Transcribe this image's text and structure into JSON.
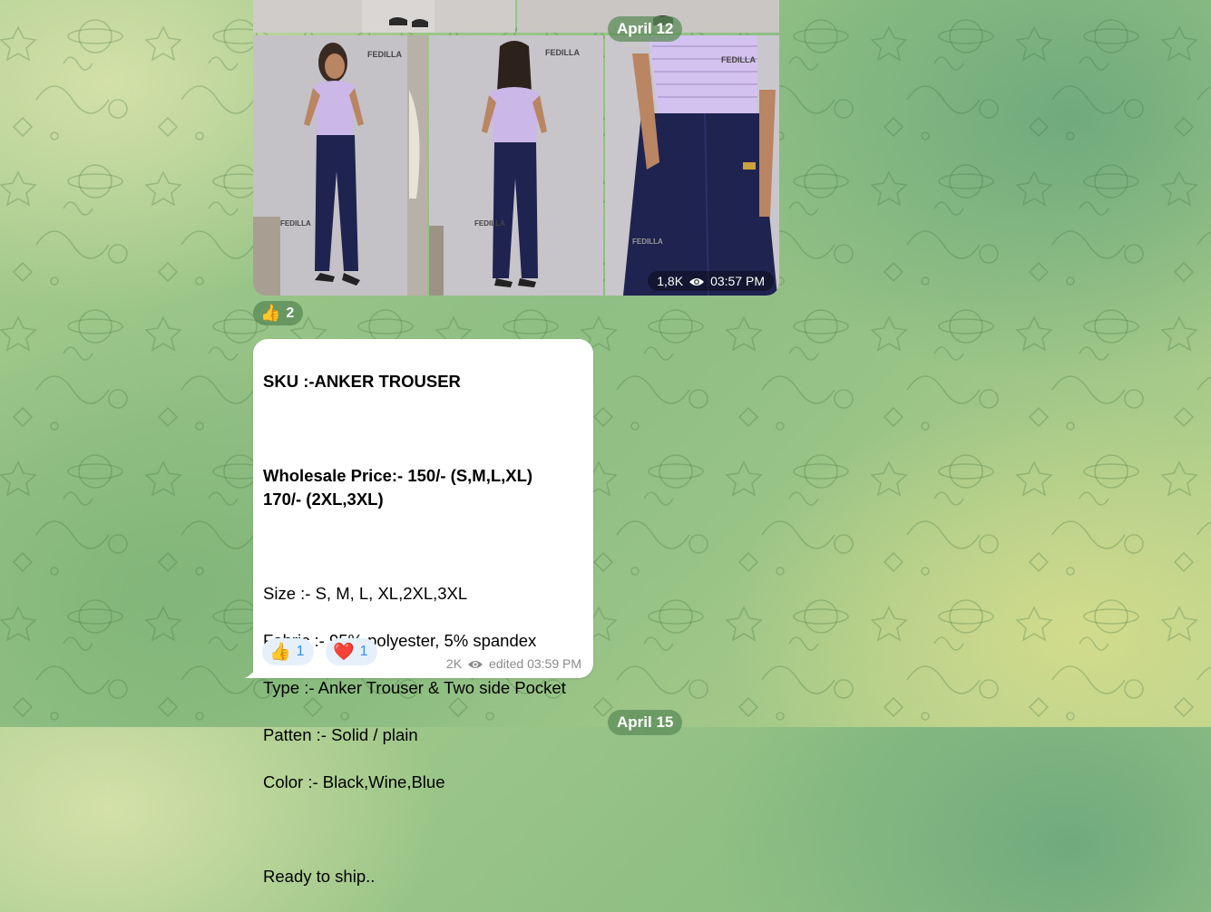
{
  "dates": {
    "first": "April 12",
    "second": "April 15"
  },
  "album": {
    "brand": "FEDILLA",
    "views": "1,8K",
    "time": "03:57 PM",
    "reaction": {
      "emoji": "👍",
      "count": "2"
    }
  },
  "message": {
    "sku": "SKU :-ANKER TROUSER",
    "wholesale": "Wholesale Price:- 150/- (S,M,L,XL)\n170/- (2XL,3XL)",
    "size": "Size :- S, M, L, XL,2XL,3XL",
    "fabric": "Fabric :- 95% polyester, 5% spandex",
    "type": "Type :- Anker Trouser & Two side Pocket",
    "pattern": "Patten :- Solid / plain",
    "color": "Color :- Black,Wine,Blue",
    "ready": "Ready to ship..",
    "reactions": [
      {
        "emoji": "👍",
        "count": "1"
      },
      {
        "emoji": "❤️",
        "count": "1"
      }
    ],
    "views": "2K",
    "time": "edited 03:59 PM"
  },
  "colors": {
    "accent": "#3390ec",
    "pill": "#5c8c58",
    "top": "#c9b8e8",
    "trouser": "#1f2350"
  }
}
